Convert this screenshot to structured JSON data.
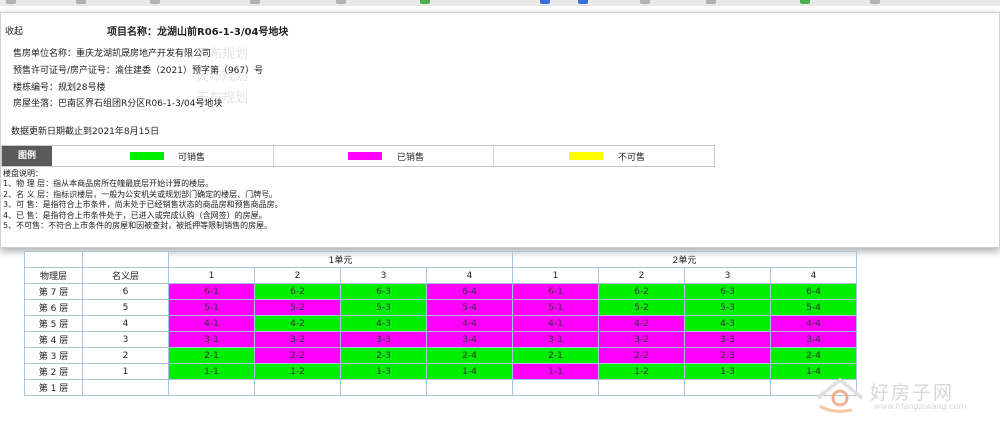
{
  "panel": {
    "collapse_label": "收起",
    "project_title": "项目名称：龙湖山前R06-1-3/04号地块",
    "developer": "售房单位名称：重庆龙湖凯晟房地产开发有限公司",
    "permit": "预售许可证号/房产证号：渝住建委（2021）预字第（967）号",
    "building_no": "楼栋编号：规划28号楼",
    "location": "房屋坐落：巴南区界石组团R分区R06-1-3/04号地块",
    "update_date": "数据更新日期截止到2021年8月15日"
  },
  "legend": {
    "title": "图例",
    "items": [
      {
        "label": "可销售",
        "color": "#00ee00"
      },
      {
        "label": "已销售",
        "color": "#ff00ff"
      },
      {
        "label": "不可售",
        "color": "#ffff00"
      }
    ]
  },
  "notes": {
    "title": "楼盘说明：",
    "lines": [
      "1、物 理 层：指从本商品房所在幢最底层开始计算的楼层。",
      "2、名 义 层：指标识楼层，一般为公安机关或规划部门确定的楼层、门牌号。",
      "3、可 售：是指符合上市条件，尚未处于已经销售状态的商品房和预售商品房。",
      "4、已 售：是指符合上市条件处于，已进入或完成认购（含网签）的房屋。",
      "5、不可售：不符合上市条件的房屋和因被查封，被抵押等限制销售的房屋。"
    ]
  },
  "table": {
    "unit_headers": [
      "1单元",
      "2单元"
    ],
    "col_headers": [
      "物理层",
      "名义层",
      "1",
      "2",
      "3",
      "4",
      "1",
      "2",
      "3",
      "4"
    ],
    "rows": [
      {
        "phys": "第 7 层",
        "nom": "6",
        "cells": [
          [
            "6-1",
            "m"
          ],
          [
            "6-2",
            "g"
          ],
          [
            "6-3",
            "g"
          ],
          [
            "6-4",
            "m"
          ],
          [
            "6-1",
            "m"
          ],
          [
            "6-2",
            "g"
          ],
          [
            "6-3",
            "g"
          ],
          [
            "6-4",
            "g"
          ]
        ]
      },
      {
        "phys": "第 6 层",
        "nom": "5",
        "cells": [
          [
            "5-1",
            "m"
          ],
          [
            "5-2",
            "m"
          ],
          [
            "5-3",
            "g"
          ],
          [
            "5-4",
            "m"
          ],
          [
            "5-1",
            "m"
          ],
          [
            "5-2",
            "g"
          ],
          [
            "5-3",
            "g"
          ],
          [
            "5-4",
            "g"
          ]
        ]
      },
      {
        "phys": "第 5 层",
        "nom": "4",
        "cells": [
          [
            "4-1",
            "m"
          ],
          [
            "4-2",
            "g"
          ],
          [
            "4-3",
            "g"
          ],
          [
            "4-4",
            "m"
          ],
          [
            "4-1",
            "m"
          ],
          [
            "4-2",
            "m"
          ],
          [
            "4-3",
            "g"
          ],
          [
            "4-4",
            "m"
          ]
        ]
      },
      {
        "phys": "第 4 层",
        "nom": "3",
        "cells": [
          [
            "3-1",
            "m"
          ],
          [
            "3-2",
            "m"
          ],
          [
            "3-3",
            "m"
          ],
          [
            "3-4",
            "m"
          ],
          [
            "3-1",
            "m"
          ],
          [
            "3-2",
            "m"
          ],
          [
            "3-3",
            "m"
          ],
          [
            "3-4",
            "m"
          ]
        ]
      },
      {
        "phys": "第 3 层",
        "nom": "2",
        "cells": [
          [
            "2-1",
            "g"
          ],
          [
            "2-2",
            "m"
          ],
          [
            "2-3",
            "g"
          ],
          [
            "2-4",
            "g"
          ],
          [
            "2-1",
            "g"
          ],
          [
            "2-2",
            "m"
          ],
          [
            "2-3",
            "m"
          ],
          [
            "2-4",
            "g"
          ]
        ]
      },
      {
        "phys": "第 2 层",
        "nom": "1",
        "cells": [
          [
            "1-1",
            "g"
          ],
          [
            "1-2",
            "g"
          ],
          [
            "1-3",
            "g"
          ],
          [
            "1-4",
            "g"
          ],
          [
            "1-1",
            "m"
          ],
          [
            "1-2",
            "g"
          ],
          [
            "1-3",
            "g"
          ],
          [
            "1-4",
            "g"
          ]
        ]
      },
      {
        "phys": "第 1 层",
        "nom": "",
        "cells": [
          [
            "",
            "w"
          ],
          [
            "",
            "w"
          ],
          [
            "",
            "w"
          ],
          [
            "",
            "w"
          ],
          [
            "",
            "w"
          ],
          [
            "",
            "w"
          ],
          [
            "",
            "w"
          ],
          [
            "",
            "w"
          ]
        ]
      }
    ]
  },
  "logo": {
    "name": "好房子网",
    "url": "www.hfangziwang.com",
    "icon": "house-logo-icon"
  },
  "bookmark_icons": [
    "bookmark-icon",
    "bookmark-icon",
    "bookmark-icon",
    "bookmark-icon",
    "bookmark-icon",
    "bookmark-icon",
    "bookmark-icon",
    "bookmark-icon",
    "bookmark-icon",
    "bookmark-icon",
    "bookmark-icon",
    "bookmark-icon"
  ]
}
